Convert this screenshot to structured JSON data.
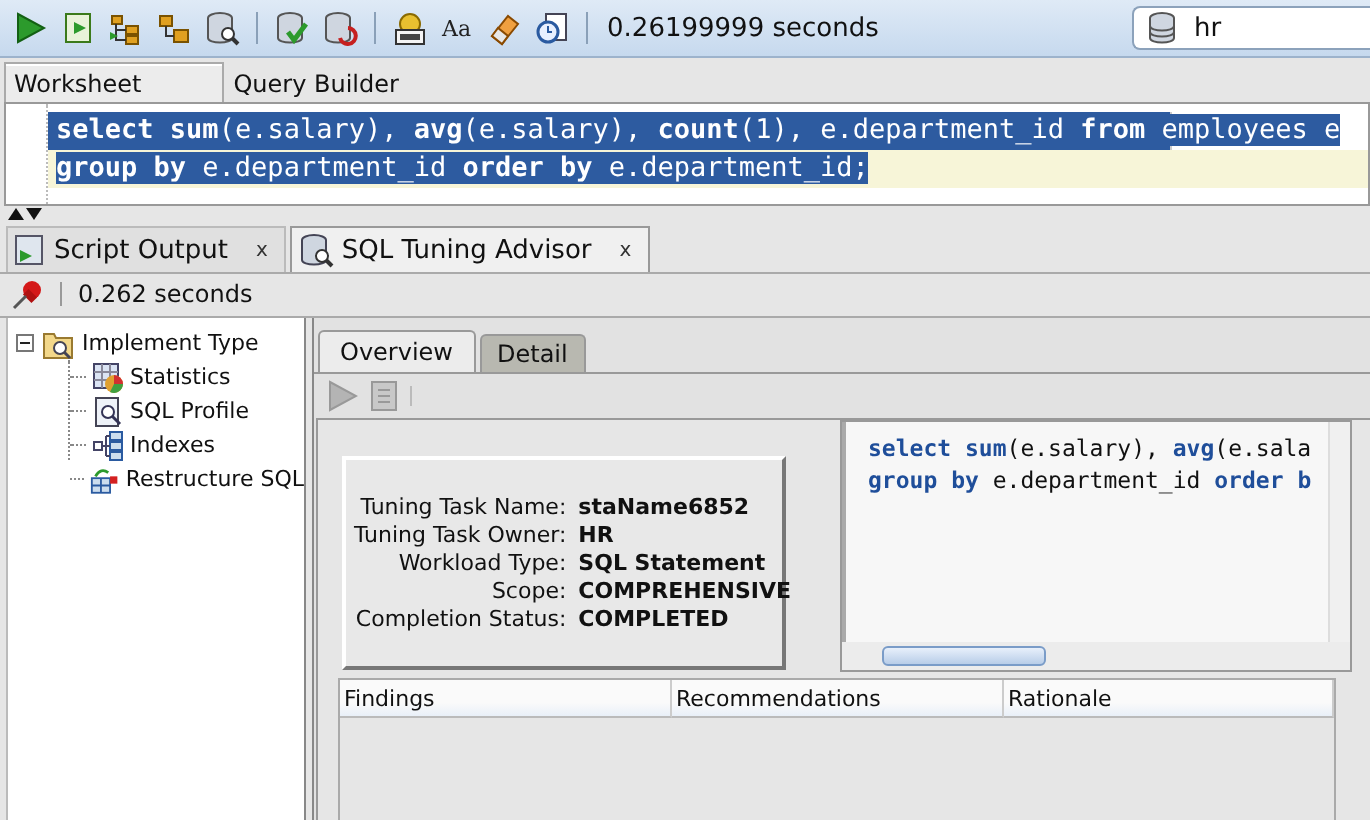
{
  "toolbar": {
    "elapsed": "0.26199999 seconds",
    "case_icon": "Aa",
    "connection": "hr"
  },
  "editor_tabs": [
    {
      "label": "Worksheet",
      "selected": true
    },
    {
      "label": "Query Builder",
      "selected": false
    }
  ],
  "editor": {
    "selected": true,
    "lines": [
      {
        "text": "**select** **sum**(e.salary), **avg**(e.salary), **count**(1), e.department_id **from** employees e",
        "current": false
      },
      {
        "text": "**group** **by** e.department_id **order** **by** e.department_id;",
        "current": true
      }
    ]
  },
  "output_tabs": [
    {
      "label": "Script Output",
      "close": "x",
      "selected": false
    },
    {
      "label": "SQL Tuning Advisor",
      "close": "x",
      "selected": true
    }
  ],
  "output_toolbar": {
    "elapsed": "0.262 seconds"
  },
  "tree": {
    "label": "Implement Type",
    "expanded": true,
    "children": [
      {
        "label": "Statistics"
      },
      {
        "label": "SQL Profile"
      },
      {
        "label": "Indexes"
      },
      {
        "label": "Restructure SQL"
      }
    ]
  },
  "advisor_tabs": [
    {
      "label": "Overview",
      "selected": true
    },
    {
      "label": "Detail",
      "selected": false
    }
  ],
  "summary": [
    {
      "label": "Tuning Task Name:",
      "value": "staName6852"
    },
    {
      "label": "Tuning Task Owner:",
      "value": "HR"
    },
    {
      "label": "Workload Type:",
      "value": "SQL Statement"
    },
    {
      "label": "Scope:",
      "value": "COMPREHENSIVE"
    },
    {
      "label": "Completion Status:",
      "value": "COMPLETED"
    }
  ],
  "sql_preview": [
    "**select** **sum**(e.salary), **avg**(e.sala",
    "**group** **by** e.department_id **order** **b**"
  ],
  "findings_table": {
    "columns": [
      "Findings",
      "Recommendations",
      "Rationale"
    ]
  }
}
